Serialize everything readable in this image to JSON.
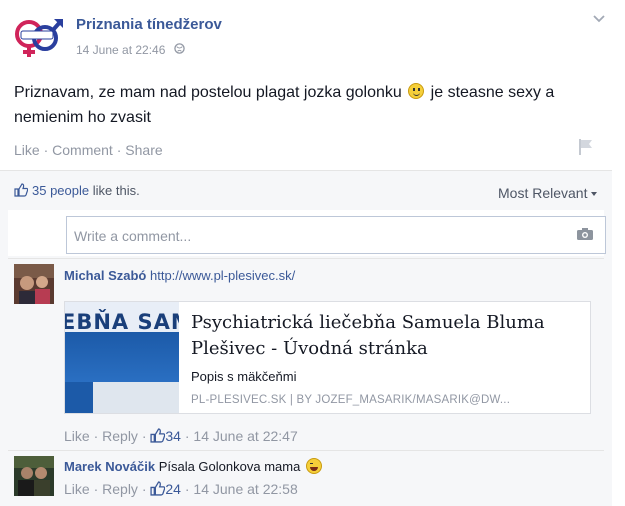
{
  "post": {
    "page_name": "Priznania tínedžerov",
    "timestamp": "14 June at 22:46",
    "text_part1": "Priznavam, ze mam nad postelou plagat jozka golonku",
    "text_part2": " je steasne sexy a nemienim ho zvasit",
    "actions": {
      "like": "Like",
      "comment": "Comment",
      "share": "Share",
      "sep": "·"
    }
  },
  "feedback": {
    "likes_count": "35 people",
    "likes_suffix": " like this.",
    "sort_label": "Most Relevant",
    "comment_placeholder": "Write a comment..."
  },
  "comments": [
    {
      "author": "Michal Szabó",
      "text": "http://www.pl-plesivec.sk/",
      "link_card": {
        "thumb_text": "EBŇA SAM",
        "title": "Psychiatrická liečebňa Samuela Bluma Plešivec - Úvodná stránka",
        "description": "Popis s mäkčeňmi",
        "source": "PL-PLESIVEC.SK | BY JOZEF_MASARIK/MASARIK@DW..."
      },
      "like": "Like",
      "reply": "Reply",
      "like_count": "34",
      "timestamp": "14 June at 22:47"
    },
    {
      "author": "Marek Nováčik",
      "text": "Písala Golonkova mama",
      "like": "Like",
      "reply": "Reply",
      "like_count": "24",
      "timestamp": "14 June at 22:58"
    }
  ],
  "colors": {
    "link": "#3b5998",
    "muted": "#9197a3",
    "feedback_bg": "#f6f7f9"
  },
  "icons": [
    "page-logo-icon",
    "globe-icon",
    "chevron-down-icon",
    "flag-icon",
    "thumbs-up-icon",
    "camera-icon",
    "smiley-icon",
    "laughing-emoji-icon"
  ]
}
